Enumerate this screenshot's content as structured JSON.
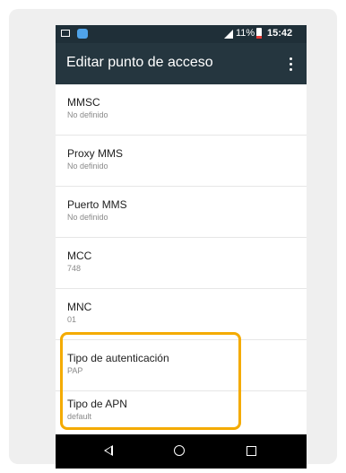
{
  "statusbar": {
    "battery": "11%",
    "time": "15:42"
  },
  "toolbar": {
    "title": "Editar punto de acceso",
    "menu_icon": "overflow-menu-icon"
  },
  "settings": [
    {
      "label": "MMSC",
      "value": "No definido"
    },
    {
      "label": "Proxy MMS",
      "value": "No definido"
    },
    {
      "label": "Puerto MMS",
      "value": "No definido"
    },
    {
      "label": "MCC",
      "value": "748"
    },
    {
      "label": "MNC",
      "value": "01"
    },
    {
      "label": "Tipo de autenticación",
      "value": "PAP"
    },
    {
      "label": "Tipo de APN",
      "value": "default"
    }
  ],
  "colors": {
    "toolbar": "#25363f",
    "statusbar": "#1f2f38",
    "highlight": "#f4ab00"
  }
}
